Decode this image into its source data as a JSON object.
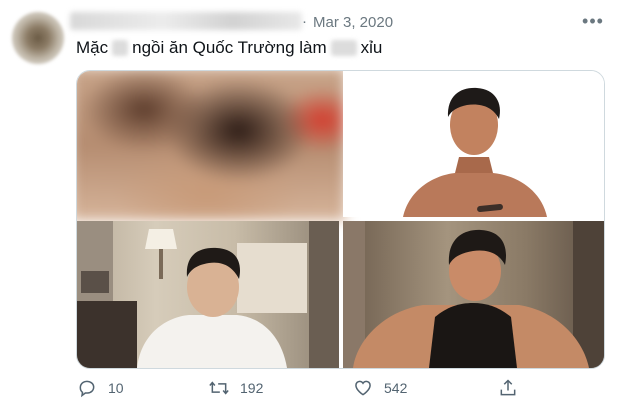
{
  "tweet": {
    "date_separator": "·",
    "date": "Mar 3, 2020",
    "more_icon": "more-horizontal-icon",
    "text_parts": [
      "Mặc",
      "ngồi ăn Quốc Trường làm",
      "xỉu"
    ]
  },
  "actions": {
    "reply": {
      "icon": "reply-icon",
      "count": "10"
    },
    "retweet": {
      "icon": "retweet-icon",
      "count": "192"
    },
    "like": {
      "icon": "heart-icon",
      "count": "542"
    },
    "share": {
      "icon": "share-icon"
    }
  },
  "colors": {
    "text_primary": "#0f1419",
    "text_secondary": "#6b7880",
    "action_gray": "#536471",
    "media_border": "#cfd9de"
  }
}
